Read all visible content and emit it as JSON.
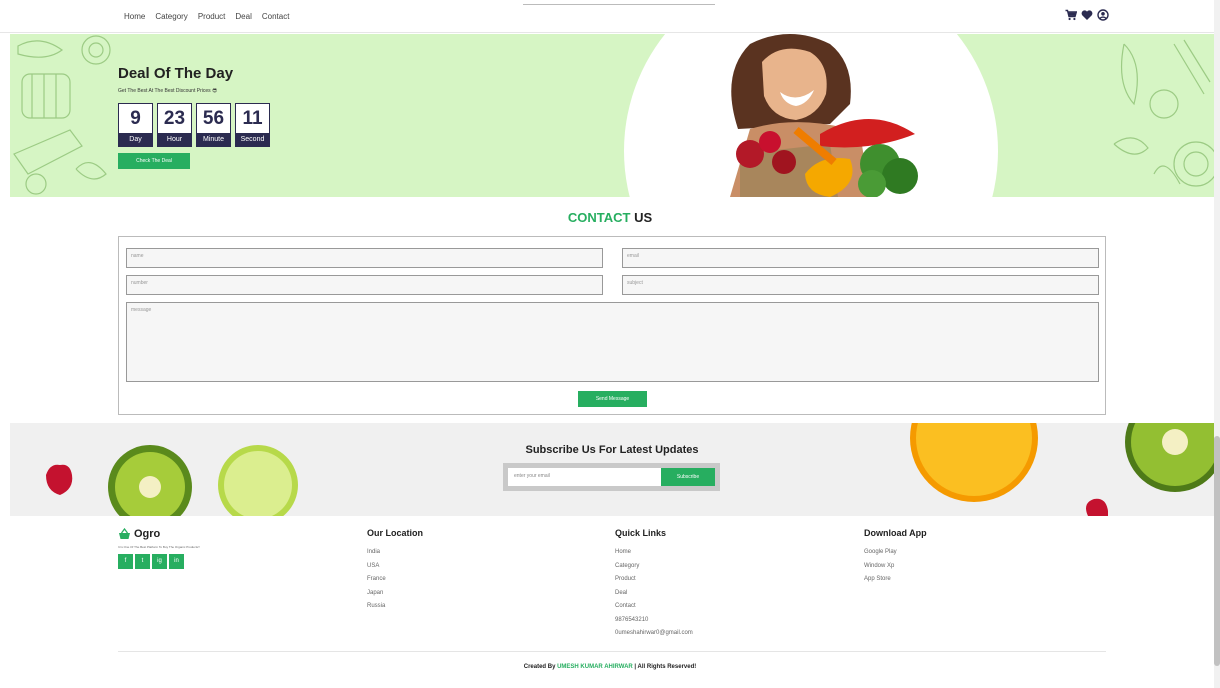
{
  "nav": {
    "items": [
      "Home",
      "Category",
      "Product",
      "Deal",
      "Contact"
    ],
    "icons": [
      "cart-icon",
      "heart-icon",
      "user-icon"
    ]
  },
  "deal": {
    "title": "Deal Of The Day",
    "subtitle": "Get The Best At The Best Discount Prices 😎",
    "countdown": [
      {
        "value": "9",
        "label": "Day"
      },
      {
        "value": "23",
        "label": "Hour"
      },
      {
        "value": "56",
        "label": "Minute"
      },
      {
        "value": "11",
        "label": "Second"
      }
    ],
    "button": "Check The Deal"
  },
  "contact": {
    "title_highlight": "CONTACT",
    "title_rest": " US",
    "placeholders": {
      "name": "name",
      "email": "email",
      "number": "number",
      "subject": "subject",
      "message": "message"
    },
    "send": "Send Message"
  },
  "subscribe": {
    "title": "Subscribe Us For Latest Updates",
    "placeholder": "enter your email",
    "button": "Subscribe"
  },
  "footer": {
    "brand": "Ogro",
    "brand_desc": "It Is One Of The Best Platform To Buy The Organic Products!!",
    "socials": [
      "f",
      "t",
      "ig",
      "in"
    ],
    "location": {
      "title": "Our Location",
      "items": [
        "India",
        "USA",
        "France",
        "Japan",
        "Russia"
      ]
    },
    "quick": {
      "title": "Quick Links",
      "items": [
        "Home",
        "Category",
        "Product",
        "Deal",
        "Contact",
        "9876543210",
        "0umeshahirwar0@gmail.com"
      ]
    },
    "download": {
      "title": "Download App",
      "items": [
        "Google Play",
        "Window Xp",
        "App Store"
      ]
    },
    "credit_prefix": "Created By ",
    "credit_name": "UMESH KUMAR AHIRWAR",
    "credit_suffix": " | All Rights Reserved!"
  },
  "colors": {
    "accent": "#27ae60",
    "navy": "#2b2b50",
    "deal_bg": "#d6f5c4"
  }
}
